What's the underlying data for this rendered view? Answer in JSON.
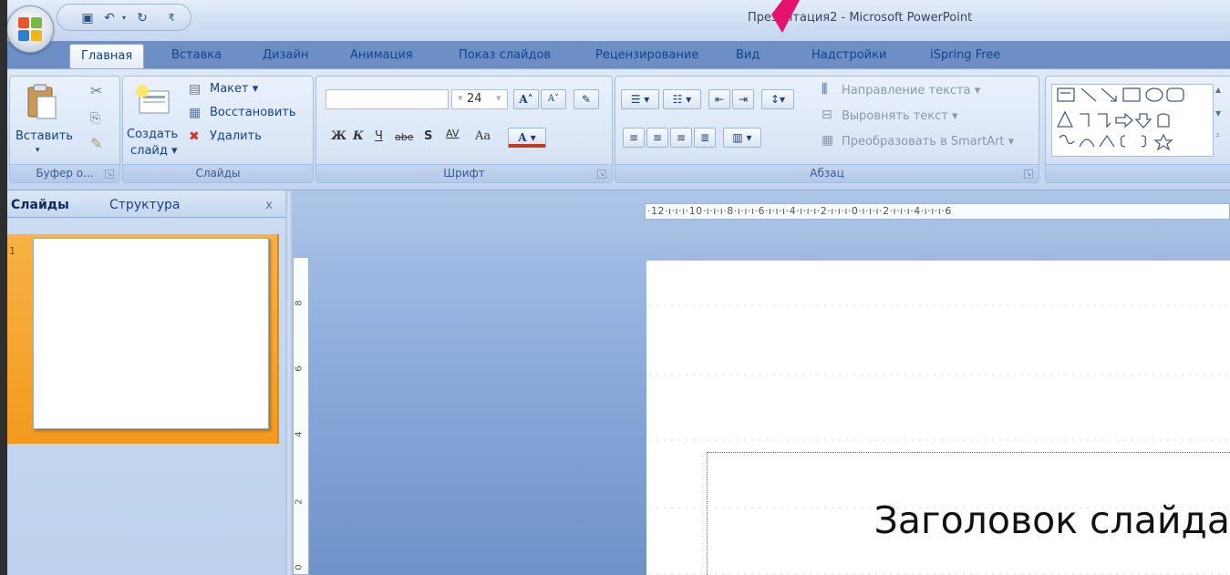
{
  "window": {
    "title": "Презентация2 - Microsoft PowerPoint"
  },
  "tabs": [
    "Главная",
    "Вставка",
    "Дизайн",
    "Анимация",
    "Показ слайдов",
    "Рецензирование",
    "Вид",
    "Надстройки",
    "iSpring Free"
  ],
  "clipboard": {
    "paste": "Вставить",
    "group": "Буфер о..."
  },
  "slides_group": {
    "create": "Создать",
    "create2": "слайд",
    "layout": "Макет",
    "reset": "Восстановить",
    "delete": "Удалить",
    "group": "Слайды"
  },
  "font": {
    "size": "24",
    "bold": "Ж",
    "italic": "К",
    "underline": "Ч",
    "strike": "abe",
    "shadow": "S",
    "spacing": "AV",
    "case": "Aa",
    "color": "A",
    "grow": "A",
    "shrink": "A",
    "group": "Шрифт"
  },
  "paragraph": {
    "text_direction": "Направление текста",
    "align_text": "Выровнять текст",
    "smartart": "Преобразовать в SmartArt",
    "group": "Абзац"
  },
  "pane": {
    "tab_slides": "Слайды",
    "tab_outline": "Структура",
    "close": "x",
    "slide_number": "1"
  },
  "ruler": {
    "horizontal": "·12·ı·ı·ı·10·ı·ı·ı·8·ı·ı·ı·6·ı·ı·ı·4·ı·ı·ı·2·ı·ı·ı·0·ı·ı·ı·2·ı·ı·ı·4·ı·ı·ı·6",
    "vertical": [
      "8",
      "6",
      "4",
      "2",
      "0"
    ]
  },
  "slide": {
    "title": "Заголовок слайда"
  },
  "colors": {
    "accent_arrow": "#e3126e",
    "selected_thumb": "#f5a52a",
    "ribbon": "#cfdff3"
  }
}
